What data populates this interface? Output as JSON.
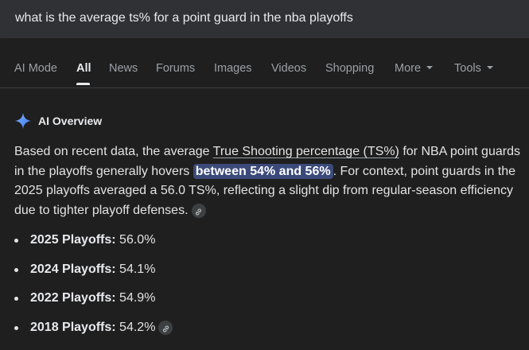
{
  "search": {
    "query": "what is the average ts% for a point guard in the nba playoffs"
  },
  "tabs": [
    {
      "label": "AI Mode"
    },
    {
      "label": "All",
      "active": true
    },
    {
      "label": "News"
    },
    {
      "label": "Forums"
    },
    {
      "label": "Images"
    },
    {
      "label": "Videos"
    },
    {
      "label": "Shopping"
    },
    {
      "label": "More"
    },
    {
      "label": "Tools"
    }
  ],
  "ai_overview": {
    "icon": "sparkle-icon",
    "title": "AI Overview",
    "summary": {
      "part1": "Based on recent data, the average ",
      "link_text": "True Shooting percentage (TS%)",
      "part2": " for NBA point guards in the playoffs generally hovers ",
      "highlight": "between 54% and 56%",
      "part3": ". For context, point guards in the 2025 playoffs averaged a 56.0 TS%, reflecting a slight dip from regular-season efficiency due to tighter playoff defenses."
    },
    "bullets": [
      {
        "label": "2025 Playoffs:",
        "value": " 56.0%"
      },
      {
        "label": "2024 Playoffs:",
        "value": " 54.1%"
      },
      {
        "label": "2022 Playoffs:",
        "value": " 54.9%"
      },
      {
        "label": "2018 Playoffs:",
        "value": " 54.2%",
        "has_link": true
      }
    ]
  },
  "colors": {
    "background": "#1f1f1f",
    "search_bar": "#303134",
    "highlight": "#3b4a7a",
    "sparkle": "#4f8df7"
  }
}
